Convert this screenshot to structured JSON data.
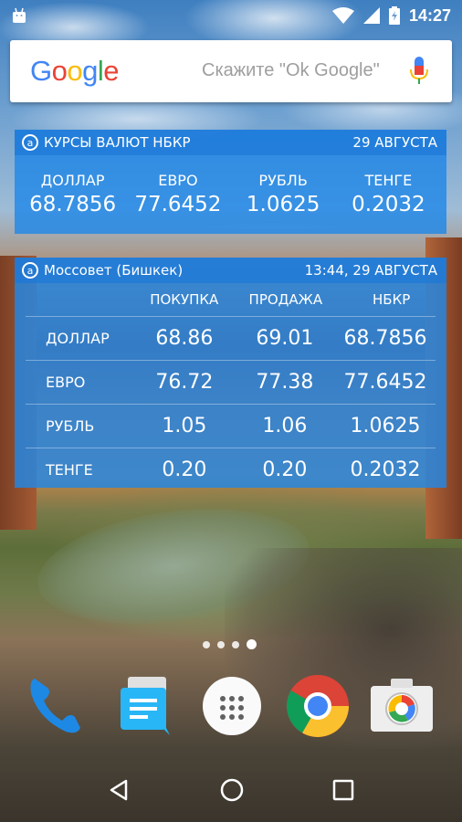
{
  "status_bar": {
    "time": "14:27",
    "left_icon": "android-icon",
    "icons": [
      "wifi-icon",
      "signal-icon",
      "battery-icon"
    ]
  },
  "google_search": {
    "logo": "Google",
    "hint": "Скажите \"Ok Google\"",
    "mic_icon": "mic-icon"
  },
  "nbkr_widget": {
    "title": "КУРСЫ ВАЛЮТ НБКР",
    "date": "29 АВГУСТА",
    "rates": [
      {
        "label": "ДОЛЛАР",
        "value": "68.7856"
      },
      {
        "label": "ЕВРО",
        "value": "77.6452"
      },
      {
        "label": "РУБЛЬ",
        "value": "1.0625"
      },
      {
        "label": "ТЕНГЕ",
        "value": "0.2032"
      }
    ]
  },
  "bank_widget": {
    "title": "Моссовет (Бишкек)",
    "datetime": "13:44, 29 АВГУСТА",
    "columns": [
      "ПОКУПКА",
      "ПРОДАЖА",
      "НБКР"
    ],
    "rows": [
      {
        "currency": "ДОЛЛАР",
        "buy": "68.86",
        "sell": "69.01",
        "nbkr": "68.7856"
      },
      {
        "currency": "ЕВРО",
        "buy": "76.72",
        "sell": "77.38",
        "nbkr": "77.6452"
      },
      {
        "currency": "РУБЛЬ",
        "buy": "1.05",
        "sell": "1.06",
        "nbkr": "1.0625"
      },
      {
        "currency": "ТЕНГЕ",
        "buy": "0.20",
        "sell": "0.20",
        "nbkr": "0.2032"
      }
    ]
  },
  "home_pages": {
    "count": 4,
    "active_index": 3
  },
  "dock": [
    "phone-icon",
    "messenger-icon",
    "app-drawer-icon",
    "chrome-icon",
    "camera-icon"
  ],
  "nav": [
    "back-icon",
    "home-icon",
    "recents-icon"
  ]
}
